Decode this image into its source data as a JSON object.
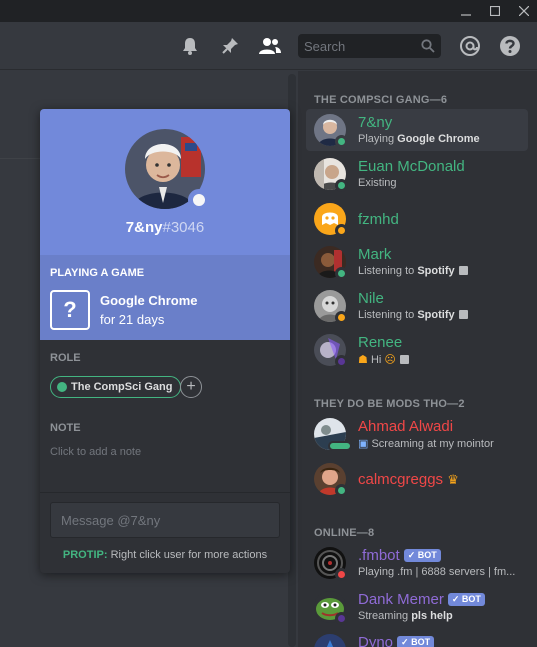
{
  "header": {
    "search_placeholder": "Search"
  },
  "profile": {
    "username": "7&ny",
    "discriminator": "#3046",
    "playing_label": "PLAYING A GAME",
    "game_name": "Google Chrome",
    "game_time": "for 21 days",
    "role_label": "ROLE",
    "role_name": "The CompSci Gang",
    "note_label": "NOTE",
    "note_placeholder": "Click to add a note",
    "message_placeholder": "Message @7&ny",
    "protip_label": "PROTIP:",
    "protip_text": "Right click user for more actions"
  },
  "members": {
    "sections": [
      {
        "label": "THE COMPSCI GANG—6"
      },
      {
        "label": "THEY DO BE MODS THO—2"
      },
      {
        "label": "ONLINE—8"
      }
    ],
    "list": [
      {
        "name": "7&ny",
        "act_prefix": "Playing ",
        "act_bold": "Google Chrome",
        "color": "#43b581",
        "status": "online"
      },
      {
        "name": "Euan McDonald",
        "act_prefix": "Existing",
        "act_bold": "",
        "color": "#43b581",
        "status": "online"
      },
      {
        "name": "fzmhd",
        "act_prefix": "",
        "act_bold": "",
        "color": "#43b581",
        "status": "idle"
      },
      {
        "name": "Mark",
        "act_prefix": "Listening to ",
        "act_bold": "Spotify",
        "color": "#43b581",
        "status": "online"
      },
      {
        "name": "Nile",
        "act_prefix": "Listening to ",
        "act_bold": "Spotify",
        "color": "#43b581",
        "status": "idle"
      },
      {
        "name": "Renee",
        "act_prefix": "Hi",
        "act_bold": "",
        "color": "#43b581",
        "status": "streaming"
      },
      {
        "name": "Ahmad Alwadi",
        "act_prefix": "Screaming at my mointor",
        "act_bold": "",
        "color": "#f04747",
        "status": "mobile"
      },
      {
        "name": "calmcgreggs",
        "act_prefix": "",
        "act_bold": "",
        "color": "#f04747",
        "status": "online"
      },
      {
        "name": ".fmbot",
        "act_prefix": "Playing .fm | 6888 servers | fm...",
        "act_bold": "",
        "color": "#7e57c2",
        "status": "dnd",
        "bot": "BOT"
      },
      {
        "name": "Dank Memer",
        "act_prefix": "Streaming ",
        "act_bold": "pls help",
        "color": "#7e57c2",
        "status": "streaming",
        "bot": "BOT"
      },
      {
        "name": "Dyno",
        "act_prefix": "",
        "act_bold": "",
        "color": "#7e57c2",
        "status": "online",
        "bot": "BOT"
      }
    ]
  },
  "colors": {
    "online": "#43b581",
    "idle": "#faa61a",
    "dnd": "#f04747",
    "streaming": "#593695",
    "blurple": "#7289da"
  }
}
